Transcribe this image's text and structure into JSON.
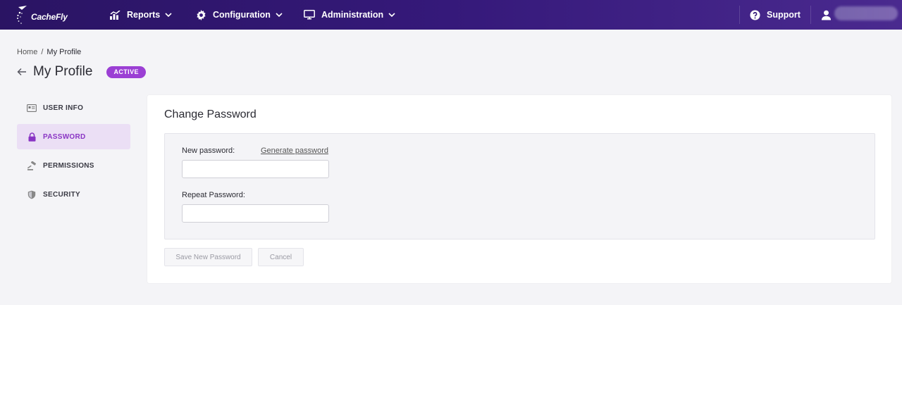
{
  "nav": {
    "logo_text": "CacheFly",
    "reports": "Reports",
    "configuration": "Configuration",
    "administration": "Administration",
    "support": "Support"
  },
  "breadcrumb": {
    "home": "Home",
    "separator": "/",
    "current": "My Profile"
  },
  "header": {
    "title": "My Profile",
    "status_badge": "ACTIVE"
  },
  "sidebar": {
    "items": [
      {
        "label": "USER INFO",
        "icon": "id-card-icon"
      },
      {
        "label": "PASSWORD",
        "icon": "lock-icon",
        "active": true
      },
      {
        "label": "PERMISSIONS",
        "icon": "gavel-icon"
      },
      {
        "label": "SECURITY",
        "icon": "shield-icon"
      }
    ]
  },
  "form": {
    "title": "Change Password",
    "new_password_label": "New password:",
    "generate_link": "Generate password",
    "new_password_value": "",
    "repeat_password_label": "Repeat Password:",
    "repeat_password_value": "",
    "save_button": "Save New Password",
    "cancel_button": "Cancel"
  },
  "colors": {
    "nav_bg": "#35197a",
    "accent": "#9b3fd4",
    "active_bg": "#ebdff5",
    "page_bg": "#f4f4f7"
  }
}
